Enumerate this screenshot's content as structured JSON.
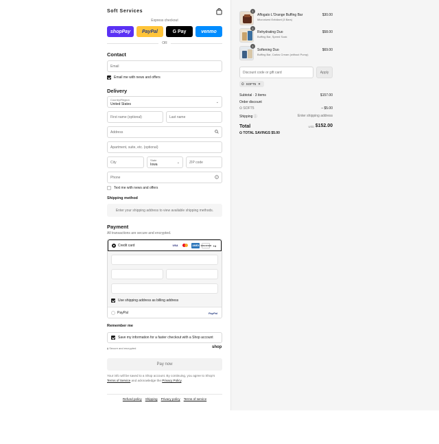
{
  "header": {
    "store_name": "Soft Services"
  },
  "express": {
    "label": "Express checkout",
    "buttons": {
      "shop": "shopPay",
      "paypal": "PayPal",
      "gpay": "G Pay",
      "venmo": "venmo"
    },
    "or": "OR"
  },
  "contact": {
    "heading": "Contact",
    "email_placeholder": "Email",
    "news_label": "Email me with news and offers"
  },
  "delivery": {
    "heading": "Delivery",
    "country_label": "Country/Region",
    "country_value": "United States",
    "first_name": "First name (optional)",
    "last_name": "Last name",
    "address": "Address",
    "apartment": "Apartment, suite, etc. (optional)",
    "city": "City",
    "state_label": "State",
    "state_value": "Iowa",
    "zip": "ZIP code",
    "phone": "Phone",
    "text_label": "Text me with news and offers"
  },
  "shipping": {
    "heading": "Shipping method",
    "notice": "Enter your shipping address to view available shipping methods."
  },
  "payment": {
    "heading": "Payment",
    "subtitle": "All transactions are secure and encrypted.",
    "credit_card": "Credit card",
    "cards": {
      "visa": "VISA",
      "amex": "AMEX",
      "discover": "DISCOVER",
      "more": "+4"
    },
    "billing_label": "Use shipping address as billing address",
    "paypal": "PayPal",
    "paypal_logo": "PayPal"
  },
  "remember": {
    "heading": "Remember me",
    "save_label": "Save my information for a faster checkout with a Shop account",
    "secure": "Secure and encrypted",
    "shop_word": "shop"
  },
  "pay_now": "Pay now",
  "legal": {
    "text": "Your info will be saved to a Shop account. By continuing, you agree to Shop's",
    "terms": "Terms of Service",
    "and": "and acknowledge the",
    "privacy": "Privacy Policy",
    "end": "."
  },
  "footer": [
    "Refund policy",
    "Shipping",
    "Privacy policy",
    "Terms of service"
  ],
  "summary": {
    "items": [
      {
        "qty": "1",
        "name": "Affogato L'Orange Buffing Bar",
        "sub": "Micronized Exfoliant (3 Bars)",
        "price": "$30.00",
        "color": "#5a2a1a"
      },
      {
        "qty": "1",
        "name": "Rehydrating Duo",
        "sub": "Buffing Bar, Speed Soak",
        "price": "$58.00",
        "color": "#c9a36b"
      },
      {
        "qty": "1",
        "name": "Softening Duo",
        "sub": "Buffing Bar, Carlos Cream (without Pump)",
        "price": "$69.00",
        "color": "#3b5f86"
      }
    ],
    "discount_placeholder": "Discount code or gift card",
    "apply": "Apply",
    "code": "SOFT5",
    "subtotal_label": "Subtotal · 3 items",
    "subtotal": "$157.00",
    "order_discount": "Order discount",
    "discount_code": "SOFT5",
    "discount_amount": "– $5.00",
    "shipping_label": "Shipping",
    "shipping_value": "Enter shipping address",
    "total_label": "Total",
    "currency": "USD",
    "total": "$152.00",
    "savings_label": "TOTAL SAVINGS",
    "savings": "$5.00"
  }
}
